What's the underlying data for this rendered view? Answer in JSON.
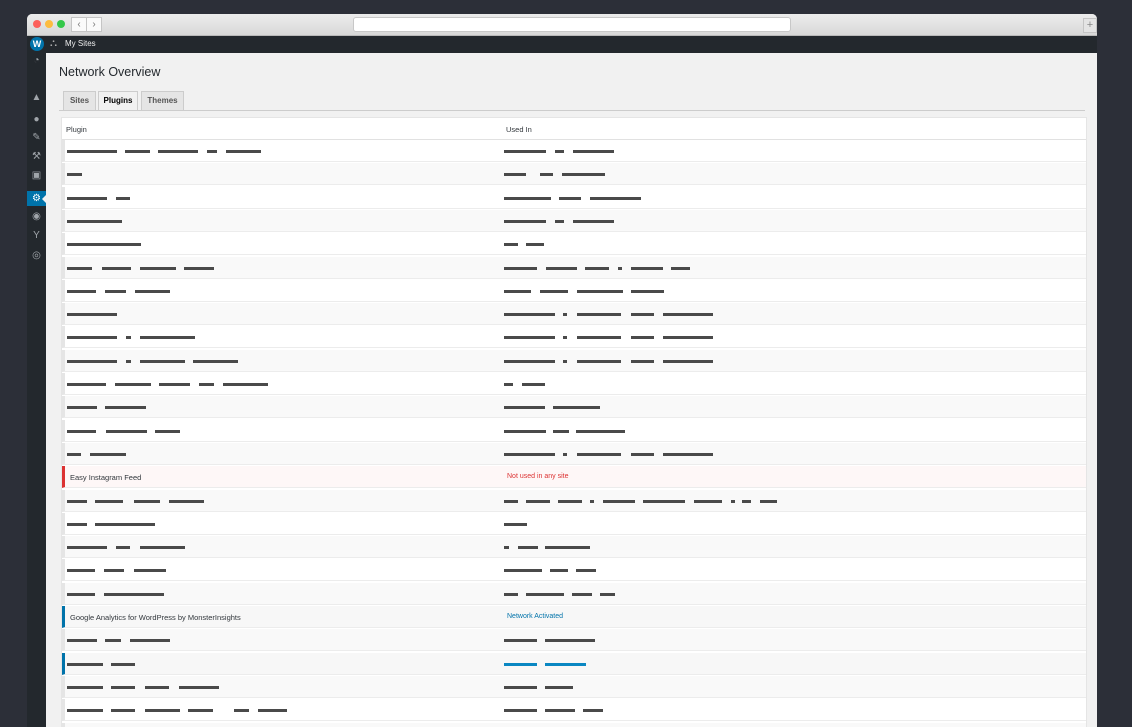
{
  "adminbar": {
    "logo_glyph": "W",
    "logo_icon": "wordpress-logo-icon",
    "my_sites_icon": "network-icon",
    "my_sites_label": "My Sites"
  },
  "sidebar": {
    "icons": [
      {
        "name": "dashboard-icon",
        "glyph": "◔"
      },
      {
        "name": "sites-icon",
        "glyph": "▲"
      },
      {
        "name": "users-icon",
        "glyph": "●"
      },
      {
        "name": "themes-icon",
        "glyph": "✎"
      },
      {
        "name": "plugins-icon",
        "glyph": "⚒"
      },
      {
        "name": "settings-icon",
        "glyph": "▣"
      },
      {
        "name": "gear-icon",
        "glyph": "⚙"
      },
      {
        "name": "user-switch-icon",
        "glyph": "◉"
      },
      {
        "name": "yoast-icon",
        "glyph": "Y"
      },
      {
        "name": "collapse-icon",
        "glyph": "◎"
      }
    ]
  },
  "page": {
    "title": "Network Overview",
    "tabs": [
      "Sites",
      "Plugins",
      "Themes"
    ]
  },
  "table": {
    "col_plugin": "Plugin",
    "col_used": "Used In",
    "highlight_rows": [
      {
        "plugin": "Easy Instagram Feed",
        "used_in": "Not used in any site",
        "status": "error"
      },
      {
        "plugin": "Google Analytics for WordPress by MonsterInsights",
        "used_in": "Network Activated",
        "status": "network"
      }
    ]
  },
  "colors": {
    "accent": "#0073aa",
    "error": "#dc3232",
    "adminbar": "#23282d"
  }
}
